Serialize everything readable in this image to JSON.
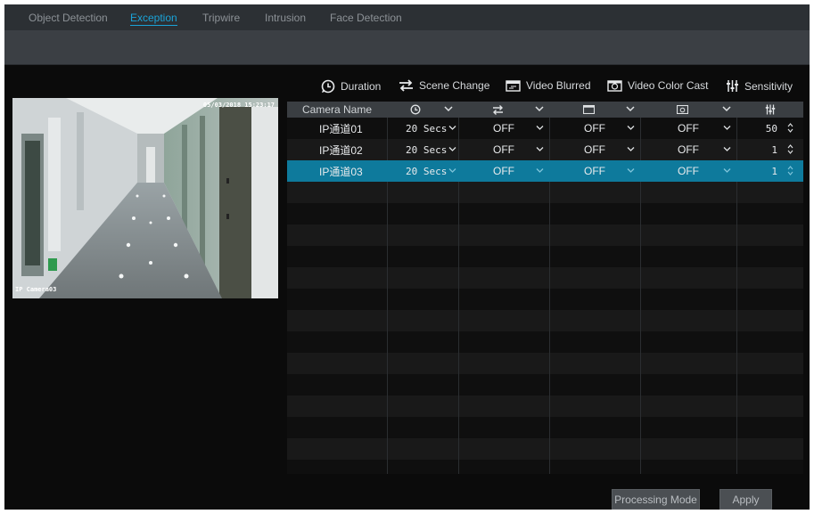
{
  "tabs": [
    {
      "label": "Object Detection",
      "active": false
    },
    {
      "label": "Exception",
      "active": true
    },
    {
      "label": "Tripwire",
      "active": false
    },
    {
      "label": "Intrusion",
      "active": false
    },
    {
      "label": "Face Detection",
      "active": false
    }
  ],
  "preview": {
    "osd_time": "05/03/2018 15:23:17",
    "osd_name": "IP Camera03"
  },
  "legend": {
    "duration": "Duration",
    "scene_change": "Scene Change",
    "video_blurred": "Video Blurred",
    "video_color_cast": "Video Color Cast",
    "sensitivity": "Sensitivity"
  },
  "table": {
    "header_camera_name": "Camera Name",
    "rows": [
      {
        "name": "IP通道01",
        "duration": "20 Secs",
        "scene_change": "OFF",
        "video_blurred": "OFF",
        "video_color_cast": "OFF",
        "sensitivity": "50",
        "selected": false
      },
      {
        "name": "IP通道02",
        "duration": "20 Secs",
        "scene_change": "OFF",
        "video_blurred": "OFF",
        "video_color_cast": "OFF",
        "sensitivity": "1",
        "selected": false
      },
      {
        "name": "IP通道03",
        "duration": "20 Secs",
        "scene_change": "OFF",
        "video_blurred": "OFF",
        "video_color_cast": "OFF",
        "sensitivity": "1",
        "selected": true
      }
    ]
  },
  "buttons": {
    "processing_mode": "Processing Mode",
    "apply": "Apply"
  },
  "colors": {
    "accent": "#1aa3d8",
    "selected_row": "#0e7a9c"
  }
}
